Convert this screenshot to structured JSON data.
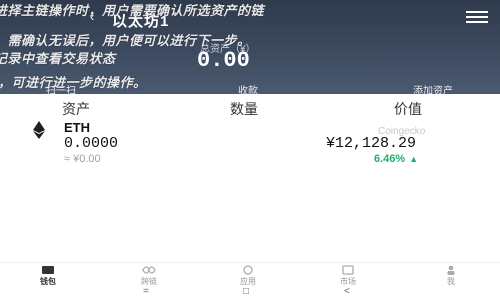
{
  "header": {
    "wallet_name": "以太坊1",
    "total_label": "总资产（¥）",
    "total_value": "0.00"
  },
  "watermark": [
    "进择主链操作时，用户需要确认所选资产的链",
    "，需确认无误后，用户便可以进行下一步。",
    "记录中查看交易状态",
    "，可进行进一步的操作。"
  ],
  "actions": [
    "扫一扫",
    "收款",
    "添加资产"
  ],
  "list_header": [
    "资产",
    "数量",
    "价值"
  ],
  "asset": {
    "symbol": "ETH",
    "amount": "0.0000",
    "fiat": "≈ ¥0.00",
    "source": "Coingecko",
    "price": "¥12,128.29",
    "change": "6.46%"
  },
  "bottom_nav": [
    "钱包",
    "跨链",
    "应用",
    "市场",
    "我"
  ],
  "system_nav": [
    "=",
    "□",
    "<"
  ],
  "colors": {
    "header": "#3d4a5f",
    "positive": "#19b36b"
  },
  "icons": [
    "menu-icon",
    "eth-logo-icon",
    "wallet-icon",
    "cross-chain-icon",
    "apps-icon",
    "market-icon",
    "me-icon"
  ]
}
